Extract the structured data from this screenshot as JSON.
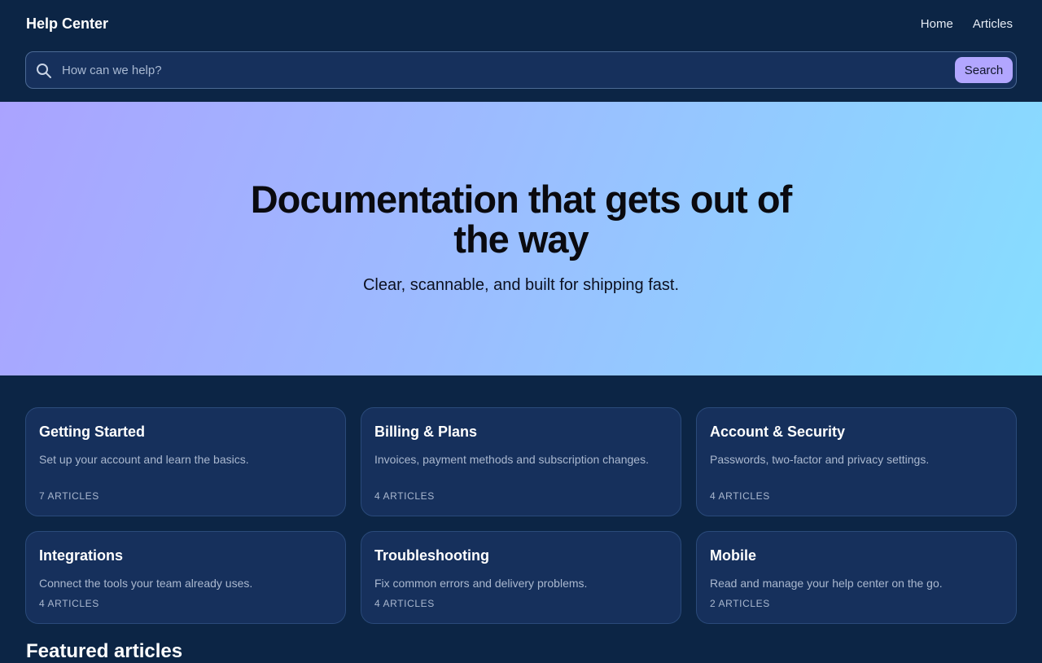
{
  "header": {
    "brand": "Help Center",
    "nav": [
      "Home",
      "Articles"
    ]
  },
  "search": {
    "placeholder": "How can we help?",
    "value": "",
    "button_label": "Search",
    "icon": "search-icon"
  },
  "hero": {
    "title": "Documentation that gets out of the way",
    "subtitle": "Clear, scannable, and built for shipping fast."
  },
  "categories": [
    {
      "title": "Getting Started",
      "description": "Set up your account and learn the basics.",
      "count": "7 ARTICLES"
    },
    {
      "title": "Billing & Plans",
      "description": "Invoices, payment methods and subscription changes.",
      "count": "4 ARTICLES"
    },
    {
      "title": "Account & Security",
      "description": "Passwords, two-factor and privacy settings.",
      "count": "4 ARTICLES"
    },
    {
      "title": "Integrations",
      "description": "Connect the tools your team already uses.",
      "count": "4 ARTICLES"
    },
    {
      "title": "Troubleshooting",
      "description": "Fix common errors and delivery problems.",
      "count": "4 ARTICLES"
    },
    {
      "title": "Mobile",
      "description": "Read and manage your help center on the go.",
      "count": "2 ARTICLES"
    }
  ],
  "featured": {
    "heading": "Featured articles"
  },
  "colors": {
    "background": "#0c2545",
    "card": "#16305c",
    "accent": "#b2a6ff",
    "hero_gradient_start": "#aaa3ff",
    "hero_gradient_end": "#86deff"
  }
}
